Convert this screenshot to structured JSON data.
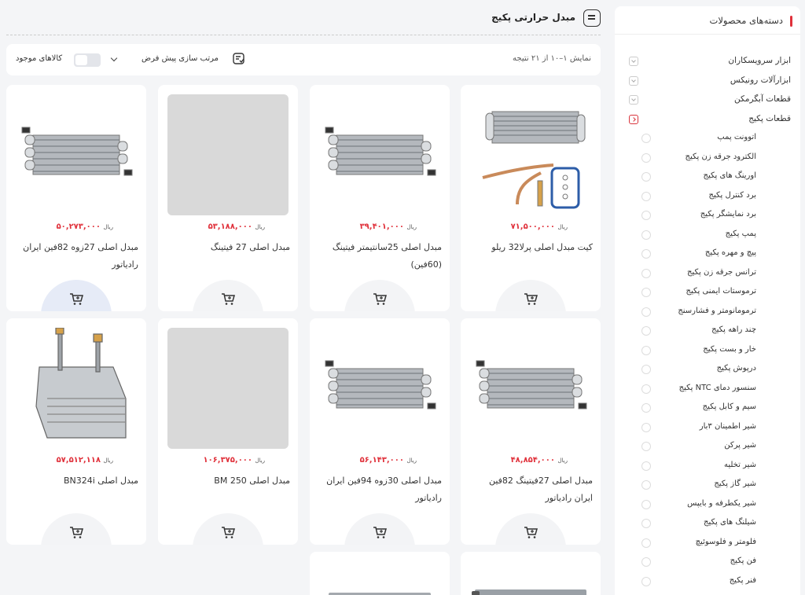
{
  "sidebar": {
    "title": "دسته‌های محصولات",
    "categories": [
      {
        "label": "ابزار سرویسکاران"
      },
      {
        "label": "ابزارآلات رونیکس"
      },
      {
        "label": "قطعات آبگرمکن"
      },
      {
        "label": "قطعات پکیج"
      }
    ],
    "subcategories": [
      {
        "label": "اتوونت پمپ"
      },
      {
        "label": "الکترود جرقه زن پکیج"
      },
      {
        "label": "اورینگ های پکیج"
      },
      {
        "label": "برد کنترل پکیج"
      },
      {
        "label": "برد نمایشگر پکیج"
      },
      {
        "label": "پمپ پکیج"
      },
      {
        "label": "پیچ و مهره پکیج"
      },
      {
        "label": "ترانس جرقه زن پکیج"
      },
      {
        "label": "ترموستات ایمنی پکیج"
      },
      {
        "label": "ترمومانومتر و فشارسنج"
      },
      {
        "label": "چند راهه پکیج"
      },
      {
        "label": "خار و بست پکیج"
      },
      {
        "label": "درپوش پکیج"
      },
      {
        "label": "سنسور دمای NTC پکیج"
      },
      {
        "label": "سیم و کابل پکیج"
      },
      {
        "label": "شیر اطمینان ۳بار"
      },
      {
        "label": "شیر پرکن"
      },
      {
        "label": "شیر تخلیه"
      },
      {
        "label": "شیر گاز پکیج"
      },
      {
        "label": "شیر یکطرفه و بایپس"
      },
      {
        "label": "شیلنگ های پکیج"
      },
      {
        "label": "فلومتر و فلوسوئیچ"
      },
      {
        "label": "فن پکیج"
      },
      {
        "label": "فنر پکیج"
      }
    ]
  },
  "header": {
    "title": "مبدل حرارتی پکیج"
  },
  "toolbar": {
    "result_text": "نمایش ۱–۱۰ از ۲۱ نتیجه",
    "sort_label": "مرتب سازی پیش فرض",
    "in_stock_label": "کالاهای موجود"
  },
  "currency": "ریال",
  "products": [
    {
      "name": "کیت مبدل اصلی پرلا32 ریلو",
      "price": "۷۱,۵۰۰,۰۰۰"
    },
    {
      "name": "مبدل اصلی 25سانتیمتر فیتینگ (60فین)",
      "price": "۳۹,۴۰۱,۰۰۰"
    },
    {
      "name": "مبدل اصلی 27 فیتینگ",
      "price": "۵۳,۱۸۸,۰۰۰"
    },
    {
      "name": "مبدل اصلی 27زوه 82فین ایران رادیاتور",
      "price": "۵۰,۲۷۳,۰۰۰"
    },
    {
      "name": "مبدل اصلی 27فیتینگ 82فین ایران رادیاتور",
      "price": "۴۸,۸۵۴,۰۰۰"
    },
    {
      "name": "مبدل اصلی 30زوه 94فین ایران رادیاتور",
      "price": "۵۶,۱۴۳,۰۰۰"
    },
    {
      "name": "مبدل اصلی BM 250",
      "price": "۱۰۶,۳۷۵,۰۰۰"
    },
    {
      "name": "مبدل اصلی BN324i",
      "price": "۵۷,۵۱۲,۱۱۸"
    }
  ],
  "colors": {
    "accent": "#e0313b",
    "background": "#f4f5f7",
    "card": "#ffffff"
  },
  "icons": {
    "menu": "menu-icon",
    "sort": "sort-icon",
    "cart": "cart-icon",
    "chevron": "chevron-down-icon"
  }
}
